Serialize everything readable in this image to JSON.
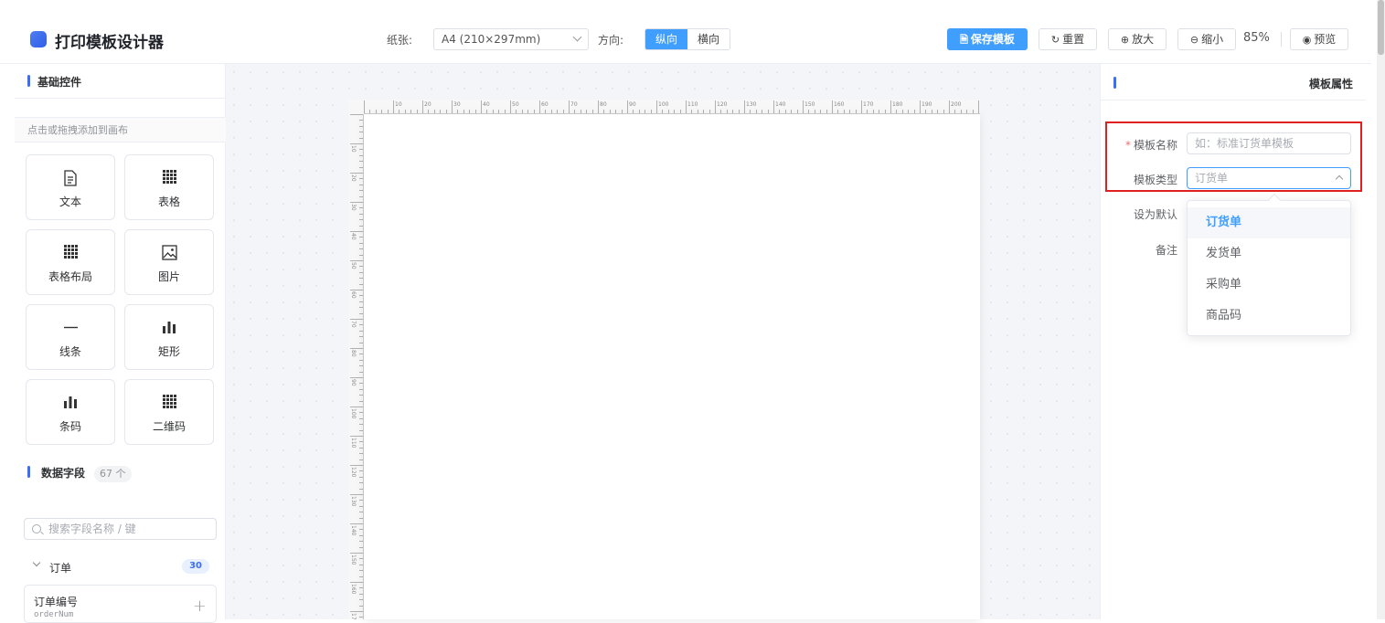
{
  "app": {
    "title": "打印模板设计器"
  },
  "toolbar": {
    "paper_label": "纸张:",
    "paper_value": "A4 (210×297mm)",
    "orientation_label": "方向:",
    "orientation_options": [
      "纵向",
      "横向"
    ],
    "orientation_selected": "纵向",
    "save_label": "保存模板",
    "reset_label": "重置",
    "zoom_in_label": "放大",
    "zoom_out_label": "缩小",
    "zoom_value": "85%",
    "preview_label": "预览"
  },
  "left": {
    "basic_title": "基础控件",
    "hint": "点击或拖拽添加到画布",
    "controls": [
      {
        "label": "文本",
        "icon": "document-icon"
      },
      {
        "label": "表格",
        "icon": "grid-icon"
      },
      {
        "label": "表格布局",
        "icon": "grid-icon"
      },
      {
        "label": "图片",
        "icon": "image-icon"
      },
      {
        "label": "线条",
        "icon": "line-icon"
      },
      {
        "label": "矩形",
        "icon": "bar-chart-icon"
      },
      {
        "label": "条码",
        "icon": "bar-chart-icon"
      },
      {
        "label": "二维码",
        "icon": "grid-icon"
      }
    ],
    "fields_title": "数据字段",
    "fields_count": "67 个",
    "search_placeholder": "搜索字段名称 / 键",
    "group": {
      "name": "订单",
      "count": "30"
    },
    "field": {
      "name": "订单编号",
      "key": "orderNum"
    }
  },
  "ruler": {
    "h_labels": [
      "10",
      "20",
      "30",
      "40",
      "50",
      "60",
      "70",
      "80",
      "90",
      "100",
      "110",
      "120",
      "130",
      "140",
      "150",
      "160",
      "170",
      "180",
      "190",
      "200"
    ],
    "v_labels": [
      "10",
      "20",
      "30",
      "40",
      "50",
      "60",
      "70",
      "80",
      "90",
      "100",
      "110",
      "120",
      "130",
      "140",
      "150",
      "160",
      "170"
    ]
  },
  "right": {
    "title": "模板属性",
    "name_label": "模板名称",
    "name_placeholder": "如：标准订货单模板",
    "type_label": "模板类型",
    "type_value": "订货单",
    "default_label": "设为默认",
    "remark_label": "备注",
    "type_options": [
      "订货单",
      "发货单",
      "采购单",
      "商品码"
    ],
    "type_selected": "订货单"
  },
  "colors": {
    "primary": "#409eff",
    "accent": "#3b6ff0",
    "highlight_border": "#e02020"
  }
}
